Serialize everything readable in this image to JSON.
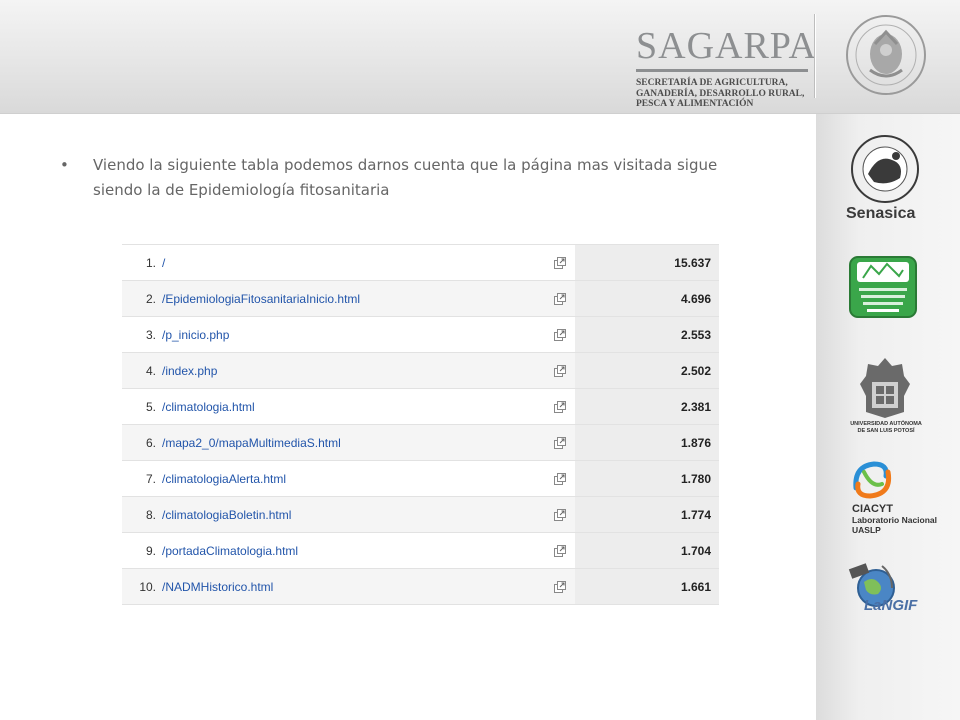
{
  "header": {
    "brand_name": "SAGARPA",
    "brand_sub_lines": [
      "SECRETARÍA DE AGRICULTURA,",
      "GANADERÍA, DESARROLLO RURAL,",
      "PESCA Y ALIMENTACIÓN"
    ],
    "seal_icon": "mexican-coat-of-arms-seal"
  },
  "slide": {
    "bullet_text": "Viendo la siguiente tabla podemos darnos cuenta que la página mas visitada sigue siendo la de Epidemiología fitosanitaria"
  },
  "table": {
    "rows": [
      {
        "rank": "1.",
        "path": "/",
        "value": "15.637"
      },
      {
        "rank": "2.",
        "path": "/EpidemiologiaFitosanitariaInicio.html",
        "value": "4.696"
      },
      {
        "rank": "3.",
        "path": "/p_inicio.php",
        "value": "2.553"
      },
      {
        "rank": "4.",
        "path": "/index.php",
        "value": "2.502"
      },
      {
        "rank": "5.",
        "path": "/climatologia.html",
        "value": "2.381"
      },
      {
        "rank": "6.",
        "path": "/mapa2_0/mapaMultimediaS.html",
        "value": "1.876"
      },
      {
        "rank": "7.",
        "path": "/climatologiaAlerta.html",
        "value": "1.780"
      },
      {
        "rank": "8.",
        "path": "/climatologiaBoletin.html",
        "value": "1.774"
      },
      {
        "rank": "9.",
        "path": "/portadaClimatologia.html",
        "value": "1.704"
      },
      {
        "rank": "10.",
        "path": "/NADMHistorico.html",
        "value": "1.661"
      }
    ],
    "row_icon": "external-link-icon"
  },
  "logos": {
    "senasica": "Senasica",
    "uaslp_lines": [
      "UNIVERSIDAD AUTÓNOMA",
      "DE SAN LUIS POTOSÍ"
    ],
    "ciacyt_lines": [
      "CIACYT",
      "Laboratorio Nacional",
      "UASLP"
    ],
    "langif": "LaNGIF"
  },
  "colors": {
    "link": "#2255aa",
    "value_bg": "#ededed",
    "brand_gray": "#8d8f91",
    "sinavef_green": "#3aa64a",
    "ciacyt_blue": "#2a8fd6",
    "ciacyt_orange": "#f07a1a"
  }
}
